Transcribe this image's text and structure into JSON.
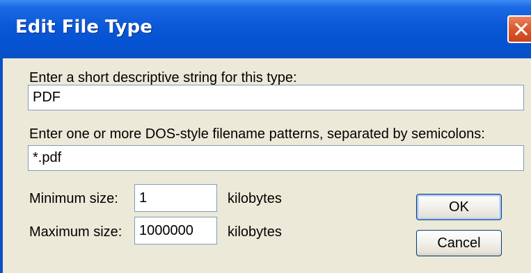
{
  "window": {
    "title": "Edit File Type",
    "close_icon": "close-x-icon"
  },
  "form": {
    "description_label": "Enter a short descriptive string for this type:",
    "description_value": "PDF",
    "patterns_label": "Enter one or more DOS-style filename patterns, separated by semicolons:",
    "patterns_value": "*.pdf",
    "min_size_label": "Minimum size:",
    "min_size_value": "1",
    "min_size_unit": "kilobytes",
    "max_size_label": "Maximum size:",
    "max_size_value": "1000000",
    "max_size_unit": "kilobytes"
  },
  "buttons": {
    "ok_label": "OK",
    "cancel_label": "Cancel"
  },
  "colors": {
    "titlebar_blue": "#0553d3",
    "close_button_red": "#dd5a30",
    "dialog_background": "#ece9d8",
    "textbox_border": "#7f9db9"
  }
}
